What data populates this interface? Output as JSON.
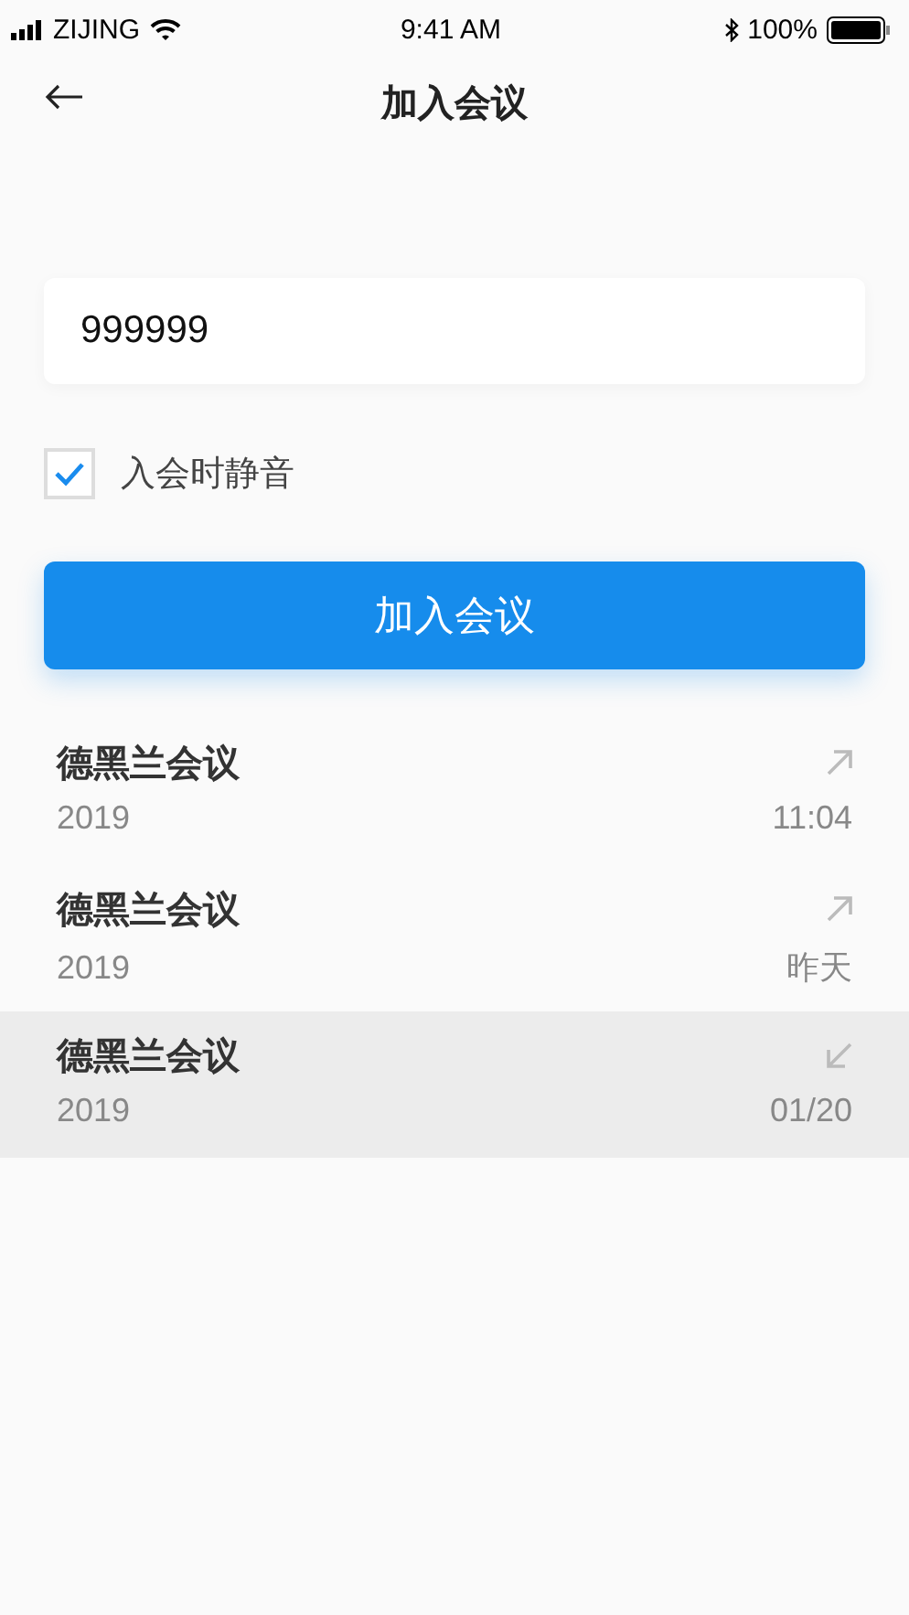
{
  "status_bar": {
    "carrier": "ZIJING",
    "time": "9:41 AM",
    "battery": "100%"
  },
  "nav": {
    "title": "加入会议"
  },
  "meeting_field": {
    "value": "999999"
  },
  "mute_option": {
    "label": "入会时静音",
    "checked": true
  },
  "join_button": {
    "label": "加入会议"
  },
  "history": [
    {
      "name": "德黑兰会议",
      "year": "2019",
      "time": "11:04",
      "kind": "outgoing",
      "selected": false
    },
    {
      "name": "德黑兰会议",
      "year": "2019",
      "time": "昨天",
      "kind": "outgoing",
      "selected": false
    },
    {
      "name": "德黑兰会议",
      "year": "2019",
      "time": "01/20",
      "kind": "incoming",
      "selected": true
    }
  ]
}
